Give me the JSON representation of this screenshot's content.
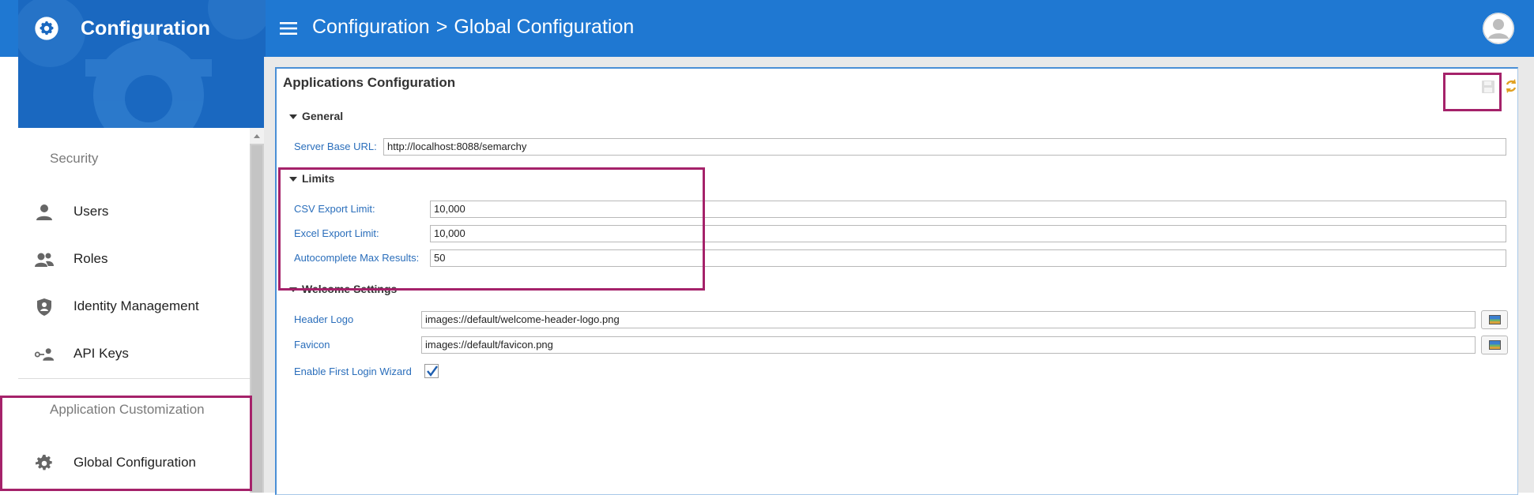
{
  "app": {
    "title": "Configuration",
    "breadcrumb": [
      "Configuration",
      ">",
      "Global Configuration"
    ]
  },
  "sidebar": {
    "sections": [
      {
        "title": "Security",
        "items": [
          {
            "label": "Users",
            "icon": "person-icon"
          },
          {
            "label": "Roles",
            "icon": "people-icon"
          },
          {
            "label": "Identity Management",
            "icon": "shield-icon"
          },
          {
            "label": "API Keys",
            "icon": "key-person-icon"
          }
        ]
      },
      {
        "title": "Application Customization",
        "items": [
          {
            "label": "Global Configuration",
            "icon": "gear-icon"
          }
        ]
      }
    ]
  },
  "panel": {
    "title": "Applications Configuration",
    "general": {
      "heading": "General",
      "server_base_url_label": "Server Base URL:",
      "server_base_url_value": "http://localhost:8088/semarchy"
    },
    "limits": {
      "heading": "Limits",
      "csv_label": "CSV Export Limit:",
      "csv_value": "10,000",
      "excel_label": "Excel Export Limit:",
      "excel_value": "10,000",
      "autocomplete_label": "Autocomplete Max Results:",
      "autocomplete_value": "50"
    },
    "welcome": {
      "heading": "Welcome Settings",
      "header_logo_label": "Header Logo",
      "header_logo_value": "images://default/welcome-header-logo.png",
      "favicon_label": "Favicon",
      "favicon_value": "images://default/favicon.png",
      "wizard_label": "Enable First Login Wizard",
      "wizard_checked": true
    }
  },
  "colors": {
    "topbar": "#1f78d2",
    "highlight": "#a5226a",
    "label_blue": "#2a6ebb"
  }
}
